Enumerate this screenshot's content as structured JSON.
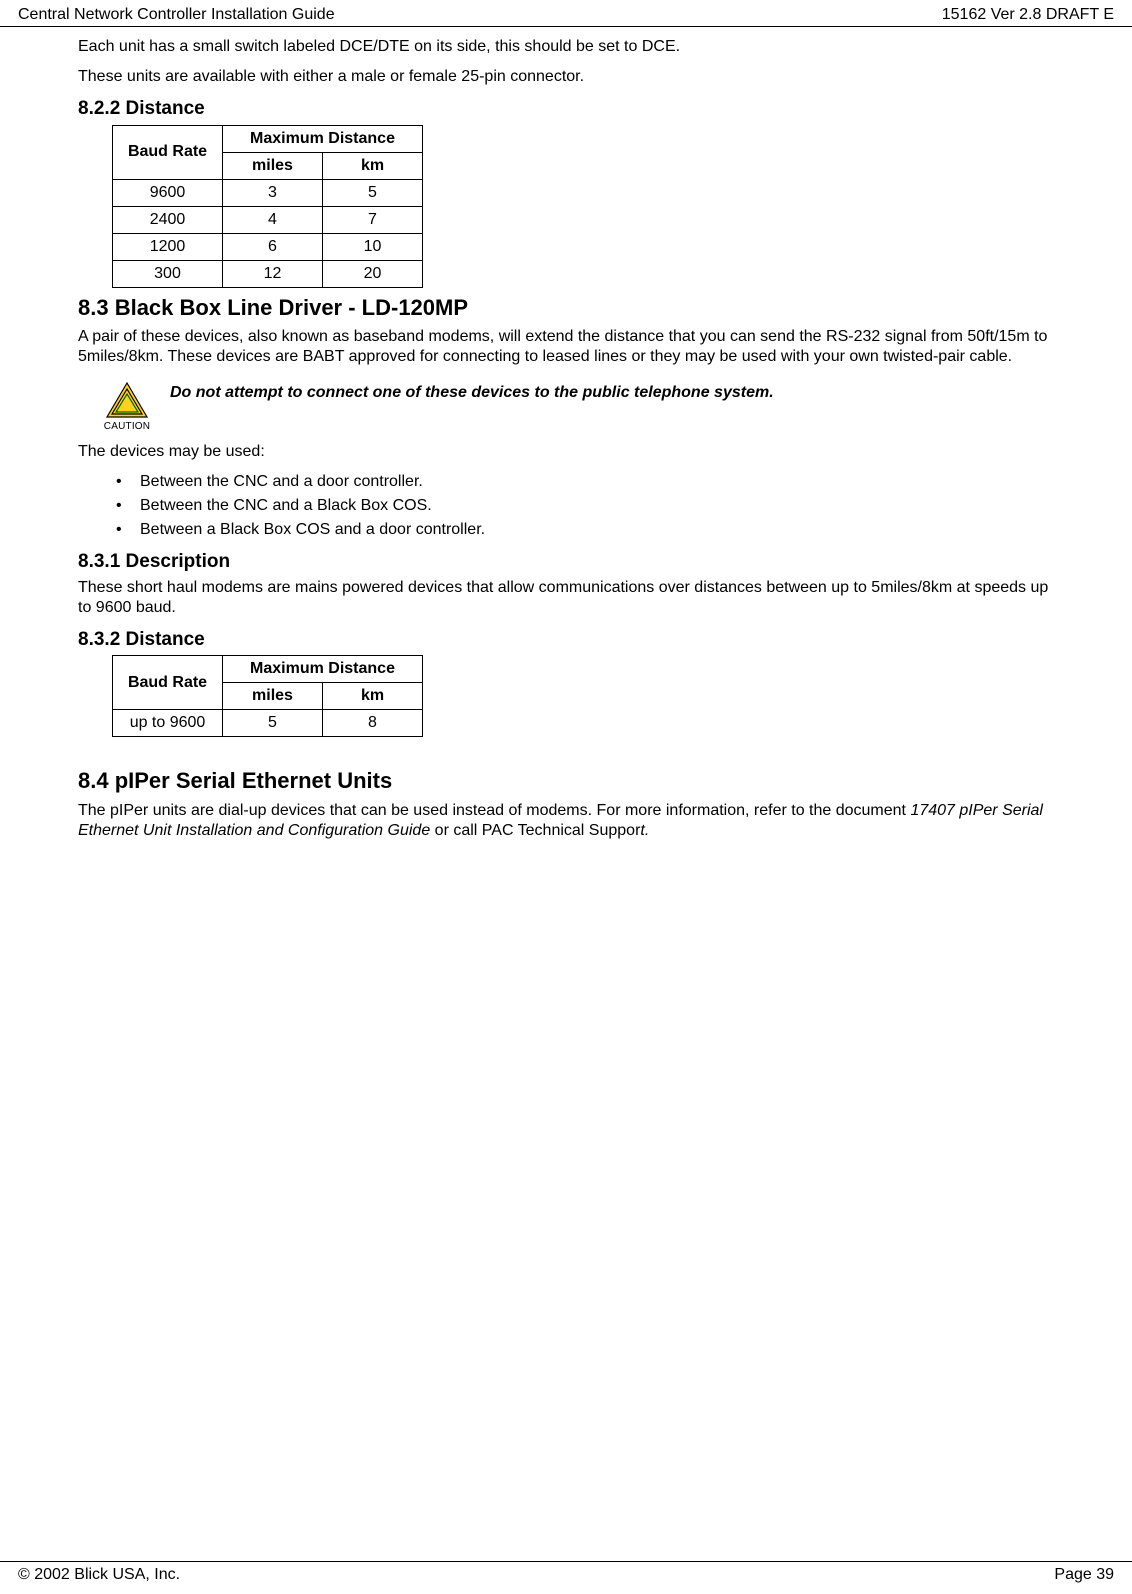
{
  "header": {
    "left": "Central Network Controller Installation Guide",
    "right": "15162 Ver 2.8 DRAFT E"
  },
  "footer": {
    "left": "© 2002 Blick USA, Inc.",
    "right": "Page 39"
  },
  "intro": {
    "p1": "Each unit has a small switch labeled DCE/DTE on its side, this should be set to DCE.",
    "p2": "These units are available with either a male or female 25-pin connector."
  },
  "s822": {
    "heading": "8.2.2 Distance",
    "th_baud": "Baud Rate",
    "th_max": "Maximum Distance",
    "th_miles": "miles",
    "th_km": "km",
    "rows": [
      {
        "baud": "9600",
        "miles": "3",
        "km": "5"
      },
      {
        "baud": "2400",
        "miles": "4",
        "km": "7"
      },
      {
        "baud": "1200",
        "miles": "6",
        "km": "10"
      },
      {
        "baud": "300",
        "miles": "12",
        "km": "20"
      }
    ]
  },
  "s83": {
    "heading": "8.3 Black Box Line Driver - LD-120MP",
    "p1": "A pair of these devices, also known as baseband modems, will extend the distance that you can send the RS-232 signal from 50ft/15m to 5miles/8km. These devices are BABT approved for connecting to leased lines or they may be used with your own twisted-pair cable.",
    "caution_label": "CAUTION",
    "caution_text": "Do not attempt to connect one of these devices to the public telephone system.",
    "p2": "The devices may be used:",
    "bullets": [
      "Between the CNC and a door controller.",
      "Between the CNC and a Black Box COS.",
      "Between a Black Box COS and a door controller."
    ]
  },
  "s831": {
    "heading": "8.3.1 Description",
    "p1": "These short haul modems are mains powered devices that allow communications over distances between up to 5miles/8km at speeds up to 9600 baud."
  },
  "s832": {
    "heading": "8.3.2 Distance",
    "th_baud": "Baud Rate",
    "th_max": "Maximum Distance",
    "th_miles": "miles",
    "th_km": "km",
    "row": {
      "baud": "up to 9600",
      "miles": "5",
      "km": "8"
    }
  },
  "s84": {
    "heading": "8.4 pIPer Serial Ethernet Units",
    "p1_a": "The pIPer units are dial-up devices that can be used instead of modems. For more information, refer to the document ",
    "p1_i": "17407 pIPer Serial Ethernet Unit Installation and Configuration Guide",
    "p1_b": " or call PAC Technical Suppor",
    "p1_c": "t."
  }
}
